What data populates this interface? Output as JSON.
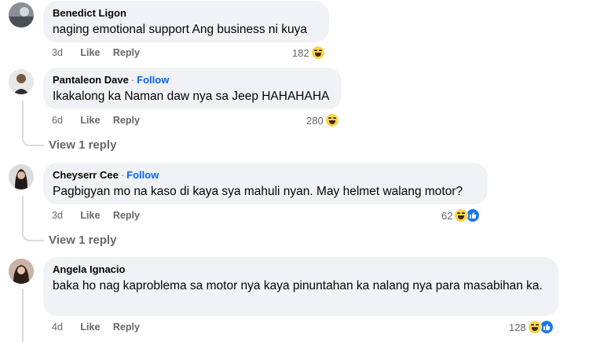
{
  "comments": [
    {
      "author": "Benedict Ligon",
      "follow": "",
      "text": "naging emotional support Ang business ni kuya",
      "time": "3d",
      "like_label": "Like",
      "reply_label": "Reply",
      "reaction_count": "182",
      "reactions": [
        "haha-icon"
      ]
    },
    {
      "author": "Pantaleon Dave",
      "follow": "Follow",
      "text": "Ikakalong ka Naman daw nya sa Jeep HAHAHAHA",
      "time": "6d",
      "like_label": "Like",
      "reply_label": "Reply",
      "reaction_count": "280",
      "reactions": [
        "haha-icon"
      ],
      "view_replies": "View 1 reply"
    },
    {
      "author": "Cheyserr Cee",
      "follow": "Follow",
      "text": "Pagbigyan mo na kaso di kaya sya mahuli nyan. May helmet walang motor?",
      "time": "3d",
      "like_label": "Like",
      "reply_label": "Reply",
      "reaction_count": "62",
      "reactions": [
        "haha-icon",
        "like-icon"
      ],
      "view_replies": "View 1 reply"
    },
    {
      "author": "Angela Ignacio",
      "follow": "",
      "text": "baka ho nag kaproblema sa motor nya kaya pinuntahan ka nalang nya para masabihan ka.",
      "time": "4d",
      "like_label": "Like",
      "reply_label": "Reply",
      "reaction_count": "128",
      "reactions": [
        "haha-icon",
        "like-icon"
      ]
    }
  ],
  "separator": "·",
  "colors": {
    "bubble": "#f0f2f5",
    "follow": "#0866ff",
    "meta": "#65676b",
    "like_reaction": "#1877f2",
    "haha_reaction": "#f7d54a"
  }
}
